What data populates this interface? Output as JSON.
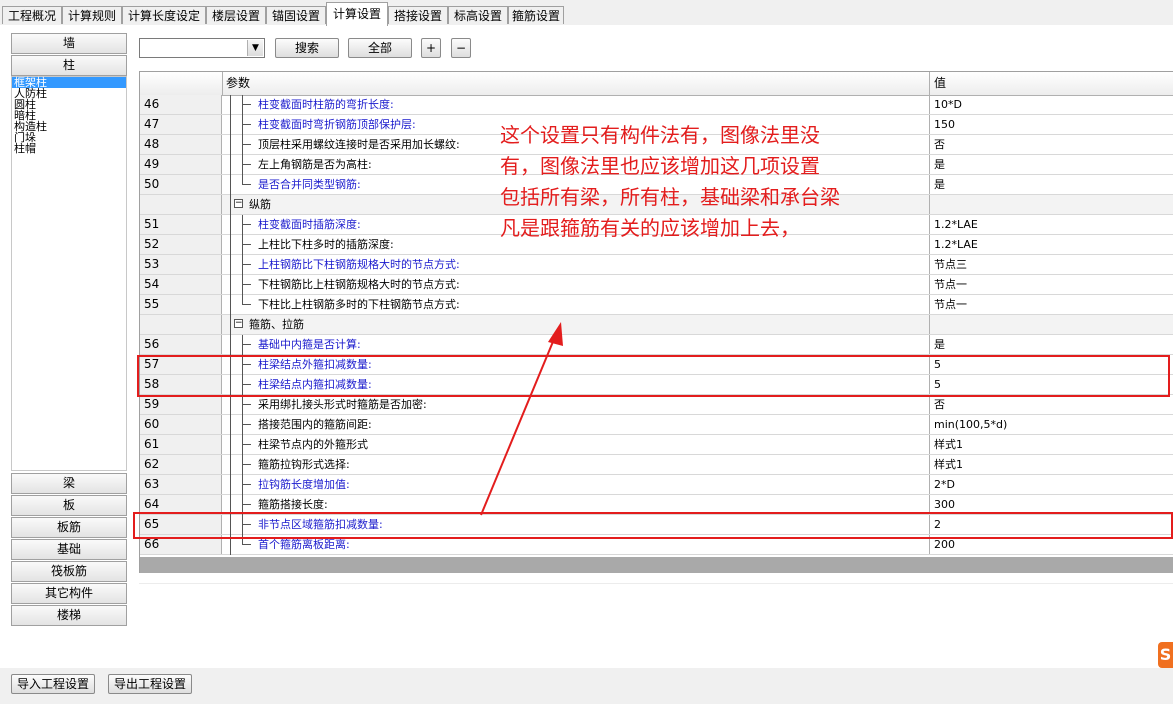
{
  "tabs": [
    "工程概况",
    "计算规则",
    "计算长度设定",
    "楼层设置",
    "锚固设置",
    "计算设置",
    "搭接设置",
    "标高设置",
    "箍筋设置"
  ],
  "active_tab": "计算设置",
  "left_top_buttons": [
    "墙",
    "柱"
  ],
  "left_categories": [
    "框架柱",
    "人防柱",
    "圆柱",
    "暗柱",
    "构造柱",
    "门垛",
    "柱帽"
  ],
  "left_selected": "框架柱",
  "left_bottom_buttons": [
    "梁",
    "板",
    "板筋",
    "基础",
    "筏板筋",
    "其它构件",
    "楼梯"
  ],
  "toolbar": {
    "combo_value": "",
    "combo_arrow": "▼",
    "search_label": "搜索",
    "all_label": "全部",
    "expand_label": "+",
    "collapse_label": "−"
  },
  "grid": {
    "header_param": "参数",
    "header_value": "值",
    "rows": [
      {
        "num": "46",
        "param": "柱变截面时柱筋的弯折长度:",
        "value": "10*D",
        "blue": true
      },
      {
        "num": "47",
        "param": "柱变截面时弯折钢筋顶部保护层:",
        "value": "150",
        "blue": true
      },
      {
        "num": "48",
        "param": "顶层柱采用螺纹连接时是否采用加长螺纹:",
        "value": "否",
        "blue": false
      },
      {
        "num": "49",
        "param": "左上角钢筋是否为高柱:",
        "value": "是",
        "blue": false
      },
      {
        "num": "50",
        "param": "是否合并同类型钢筋:",
        "value": "是",
        "blue": true
      },
      {
        "num": "",
        "param": "纵筋",
        "value": "",
        "group": true
      },
      {
        "num": "51",
        "param": "柱变截面时插筋深度:",
        "value": "1.2*LAE",
        "blue": true
      },
      {
        "num": "52",
        "param": "上柱比下柱多时的插筋深度:",
        "value": "1.2*LAE",
        "blue": false
      },
      {
        "num": "53",
        "param": "上柱钢筋比下柱钢筋规格大时的节点方式:",
        "value": "节点三",
        "blue": true
      },
      {
        "num": "54",
        "param": "下柱钢筋比上柱钢筋规格大时的节点方式:",
        "value": "节点一",
        "blue": false
      },
      {
        "num": "55",
        "param": "下柱比上柱钢筋多时的下柱钢筋节点方式:",
        "value": "节点一",
        "blue": false
      },
      {
        "num": "",
        "param": "箍筋、拉筋",
        "value": "",
        "group": true
      },
      {
        "num": "56",
        "param": "基础中内箍是否计算:",
        "value": "是",
        "blue": true
      },
      {
        "num": "57",
        "param": "柱梁结点外箍扣减数量:",
        "value": "5",
        "blue": true
      },
      {
        "num": "58",
        "param": "柱梁结点内箍扣减数量:",
        "value": "5",
        "blue": true
      },
      {
        "num": "59",
        "param": "采用绑扎接头形式时箍筋是否加密:",
        "value": "否",
        "blue": false
      },
      {
        "num": "60",
        "param": "搭接范围内的箍筋间距:",
        "value": "min(100,5*d)",
        "blue": false
      },
      {
        "num": "61",
        "param": "柱梁节点内的外箍形式",
        "value": "样式1",
        "blue": false
      },
      {
        "num": "62",
        "param": "箍筋拉钩形式选择:",
        "value": "样式1",
        "blue": false
      },
      {
        "num": "63",
        "param": "拉钩筋长度增加值:",
        "value": "2*D",
        "blue": true
      },
      {
        "num": "64",
        "param": "箍筋搭接长度:",
        "value": "300",
        "blue": false
      },
      {
        "num": "65",
        "param": "非节点区域箍筋扣减数量:",
        "value": "2",
        "blue": true
      },
      {
        "num": "66",
        "param": "首个箍筋离板距离:",
        "value": "200",
        "blue": true
      }
    ]
  },
  "annotation": {
    "lines": [
      "这个设置只有构件法有，图像法里没",
      "有，图像法里也应该增加这几项设置",
      "包括所有梁，所有柱，基础梁和承台梁",
      "凡是跟箍筋有关的应该增加上去，"
    ],
    "color": "#e31d1d"
  },
  "bottom_buttons": [
    "导入工程设置",
    "导出工程设置"
  ],
  "colors": {
    "highlight_red": "#e31d1d",
    "param_blue": "#1a1acd",
    "selection_blue": "#3399ff"
  }
}
